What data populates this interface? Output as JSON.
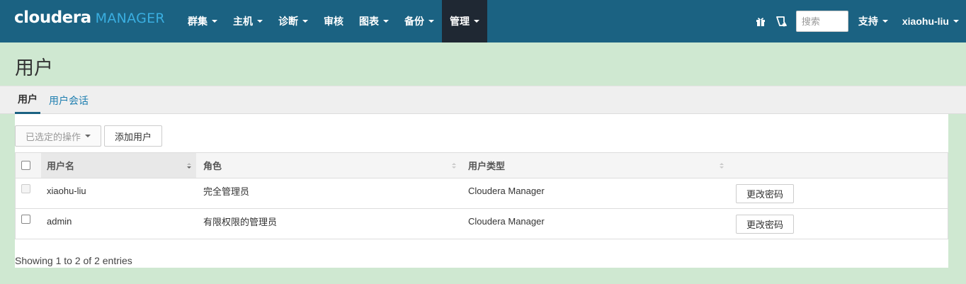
{
  "brand": {
    "name": "cloudera",
    "product": "MANAGER"
  },
  "nav": {
    "items": [
      {
        "label": "群集",
        "has_caret": true
      },
      {
        "label": "主机",
        "has_caret": true
      },
      {
        "label": "诊断",
        "has_caret": true
      },
      {
        "label": "审核",
        "has_caret": false
      },
      {
        "label": "图表",
        "has_caret": true
      },
      {
        "label": "备份",
        "has_caret": true
      },
      {
        "label": "管理",
        "has_caret": true,
        "active": true
      }
    ],
    "right": {
      "icons": [
        "gift-icon",
        "notification-icon"
      ],
      "search_placeholder": "搜索",
      "support_label": "支持",
      "user_label": "xiaohu-liu"
    }
  },
  "page": {
    "title": "用户",
    "tabs": [
      {
        "label": "用户",
        "active": true
      },
      {
        "label": "用户会话",
        "active": false
      }
    ]
  },
  "toolbar": {
    "actions_label": "已选定的操作",
    "add_user_label": "添加用户"
  },
  "table": {
    "columns": [
      "用户名",
      "角色",
      "用户类型",
      ""
    ],
    "rows": [
      {
        "username": "xiaohu-liu",
        "role": "完全管理员",
        "user_type": "Cloudera Manager",
        "action": "更改密码",
        "checkbox_disabled": true
      },
      {
        "username": "admin",
        "role": "有限权限的管理员",
        "user_type": "Cloudera Manager",
        "action": "更改密码",
        "checkbox_disabled": false
      }
    ],
    "footer": "Showing 1 to 2 of 2 entries"
  },
  "colors": {
    "navbar": "#1b6282",
    "nav_active": "#1f2833",
    "page_background": "#cfe8d1",
    "link": "#1f7fb0",
    "brand_accent": "#3aaee0"
  }
}
